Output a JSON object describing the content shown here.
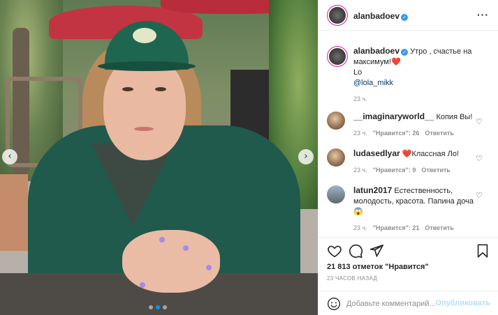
{
  "post": {
    "author": "alanbadoev",
    "menu_icon": "more-dots-icon"
  },
  "photo": {
    "prev_icon": "chevron-left-icon",
    "next_icon": "chevron-right-icon",
    "carousel_index": 2,
    "carousel_count": 3
  },
  "caption": {
    "username": "alanbadoev",
    "text": "Утро , счастье на максимум!❤️",
    "line2": "Lo",
    "mention": "@lola_mikk",
    "time": "23 ч."
  },
  "comments": [
    {
      "username": "__imaginaryworld__",
      "text": "Копия Вы!",
      "time": "23 ч.",
      "likes": "\"Нравится\": 26",
      "reply": "Ответить"
    },
    {
      "username": "ludasedlyar",
      "text": "❤️Классная Ло!",
      "time": "23 ч.",
      "likes": "\"Нравится\": 9",
      "reply": "Ответить"
    },
    {
      "username": "latun2017",
      "text": "Естественность, молодость, красота. Папина доча😱",
      "time": "23 ч.",
      "likes": "\"Нравится\": 21",
      "reply": "Ответить"
    }
  ],
  "actions": {
    "likes_text": "21 813 отметок \"Нравится\"",
    "time_ago": "23 ЧАСОВ НАЗАД"
  },
  "add_comment": {
    "placeholder": "Добавьте комментарий...",
    "publish_label": "Опубликовать"
  },
  "colors": {
    "link": "#00376b",
    "verified": "#3897f0",
    "publish_disabled": "#b2dffc",
    "muted": "#8e8e8e"
  }
}
